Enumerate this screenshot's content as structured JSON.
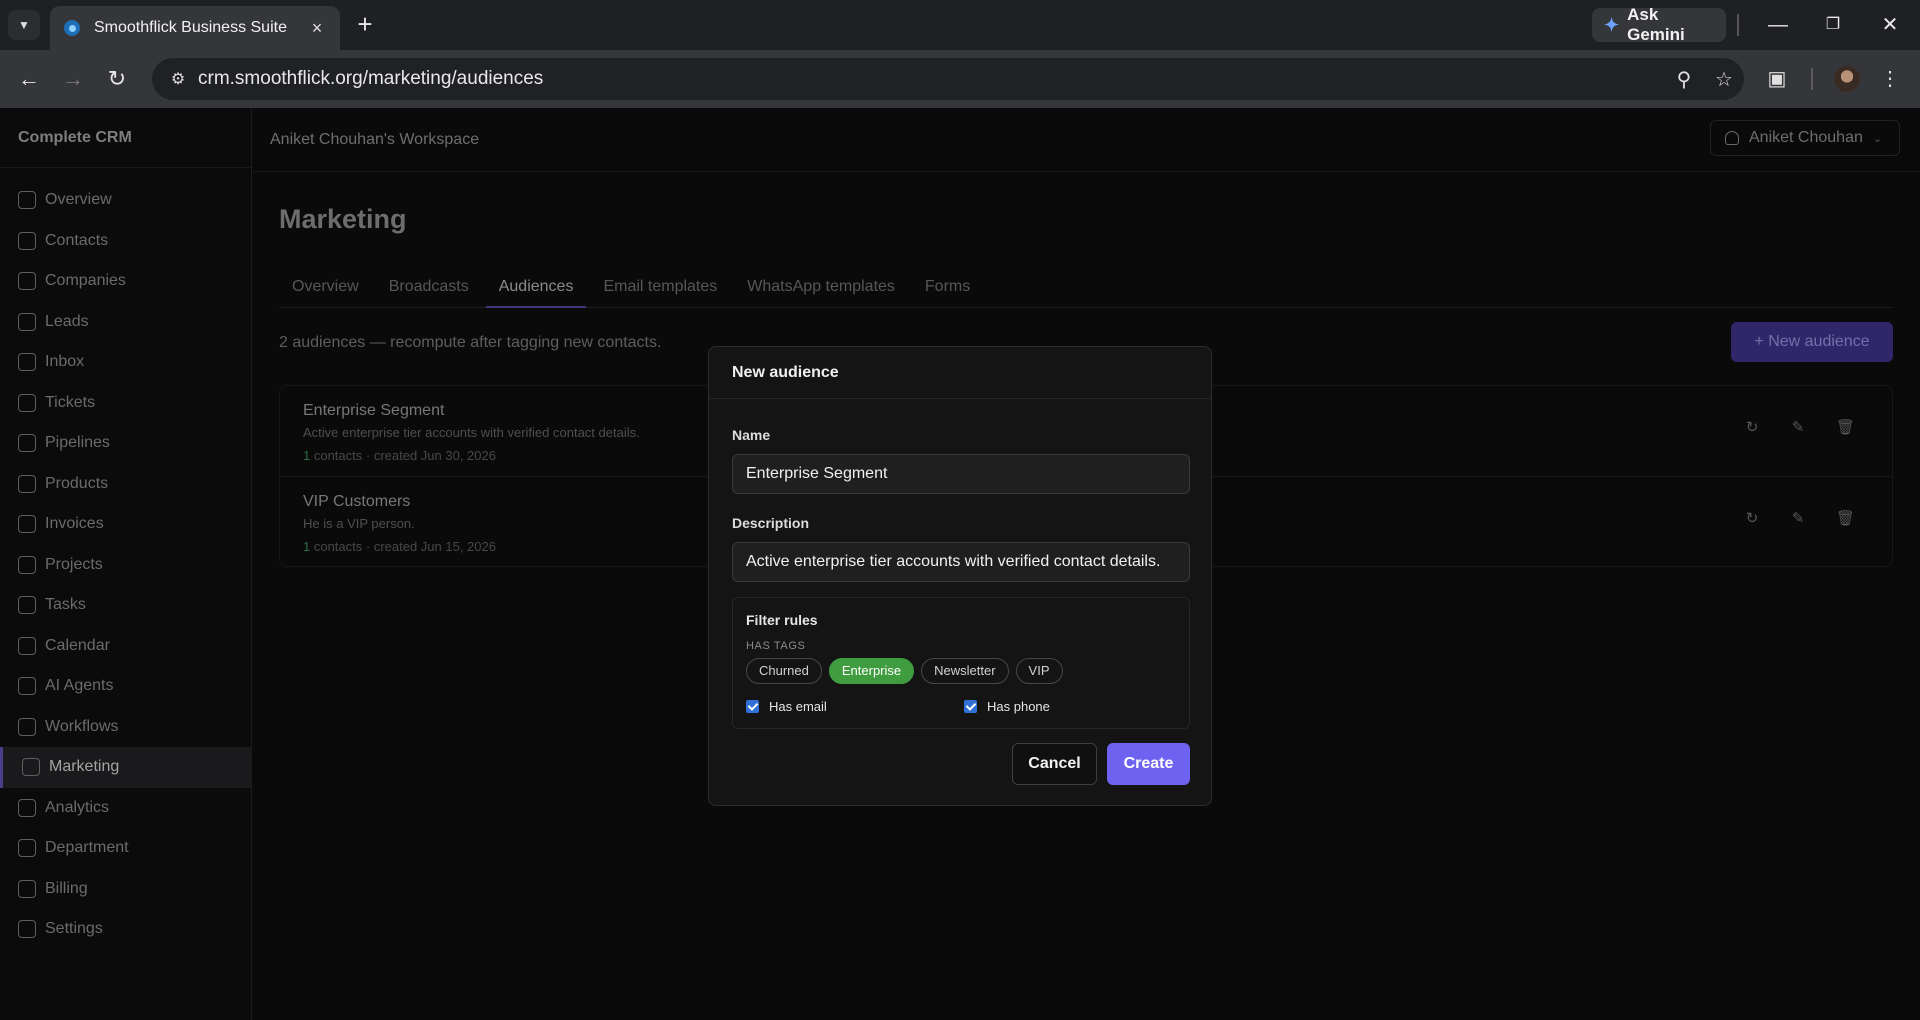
{
  "browser": {
    "tab_title": "Smoothflick Business Suite",
    "ask_gemini": "Ask Gemini",
    "url": "crm.smoothflick.org/marketing/audiences"
  },
  "app": {
    "brand": "Complete CRM",
    "workspace": "Aniket Chouhan's Workspace",
    "user_name": "Aniket Chouhan",
    "nav": [
      {
        "label": "Overview"
      },
      {
        "label": "Contacts"
      },
      {
        "label": "Companies"
      },
      {
        "label": "Leads"
      },
      {
        "label": "Inbox"
      },
      {
        "label": "Tickets"
      },
      {
        "label": "Pipelines"
      },
      {
        "label": "Products"
      },
      {
        "label": "Invoices"
      },
      {
        "label": "Projects"
      },
      {
        "label": "Tasks"
      },
      {
        "label": "Calendar"
      },
      {
        "label": "AI Agents"
      },
      {
        "label": "Workflows"
      },
      {
        "label": "Marketing"
      },
      {
        "label": "Analytics"
      },
      {
        "label": "Department"
      },
      {
        "label": "Billing"
      },
      {
        "label": "Settings"
      }
    ],
    "active_nav": "Marketing"
  },
  "page": {
    "title": "Marketing",
    "tabs": [
      "Overview",
      "Broadcasts",
      "Audiences",
      "Email templates",
      "WhatsApp templates",
      "Forms"
    ],
    "active_tab": "Audiences",
    "subtitle": "2 audiences — recompute after tagging new contacts.",
    "new_audience": "+ New audience",
    "audiences": [
      {
        "name": "Enterprise Segment",
        "description": "Active enterprise tier accounts with verified contact details.",
        "count": "1",
        "meta": " contacts · created Jun 30, 2026"
      },
      {
        "name": "VIP Customers",
        "description": "He is a VIP person.",
        "count": "1",
        "meta": " contacts · created Jun 15, 2026"
      }
    ]
  },
  "modal": {
    "title": "New audience",
    "name_label": "Name",
    "name_value": "Enterprise Segment",
    "description_label": "Description",
    "description_value": "Active enterprise tier accounts with verified contact details.",
    "filter_title": "Filter rules",
    "has_tags_label": "HAS TAGS",
    "tags": [
      {
        "label": "Churned",
        "selected": false
      },
      {
        "label": "Enterprise",
        "selected": true
      },
      {
        "label": "Newsletter",
        "selected": false
      },
      {
        "label": "VIP",
        "selected": false
      }
    ],
    "has_email": "Has email",
    "has_phone": "Has phone",
    "cancel": "Cancel",
    "create": "Create"
  }
}
